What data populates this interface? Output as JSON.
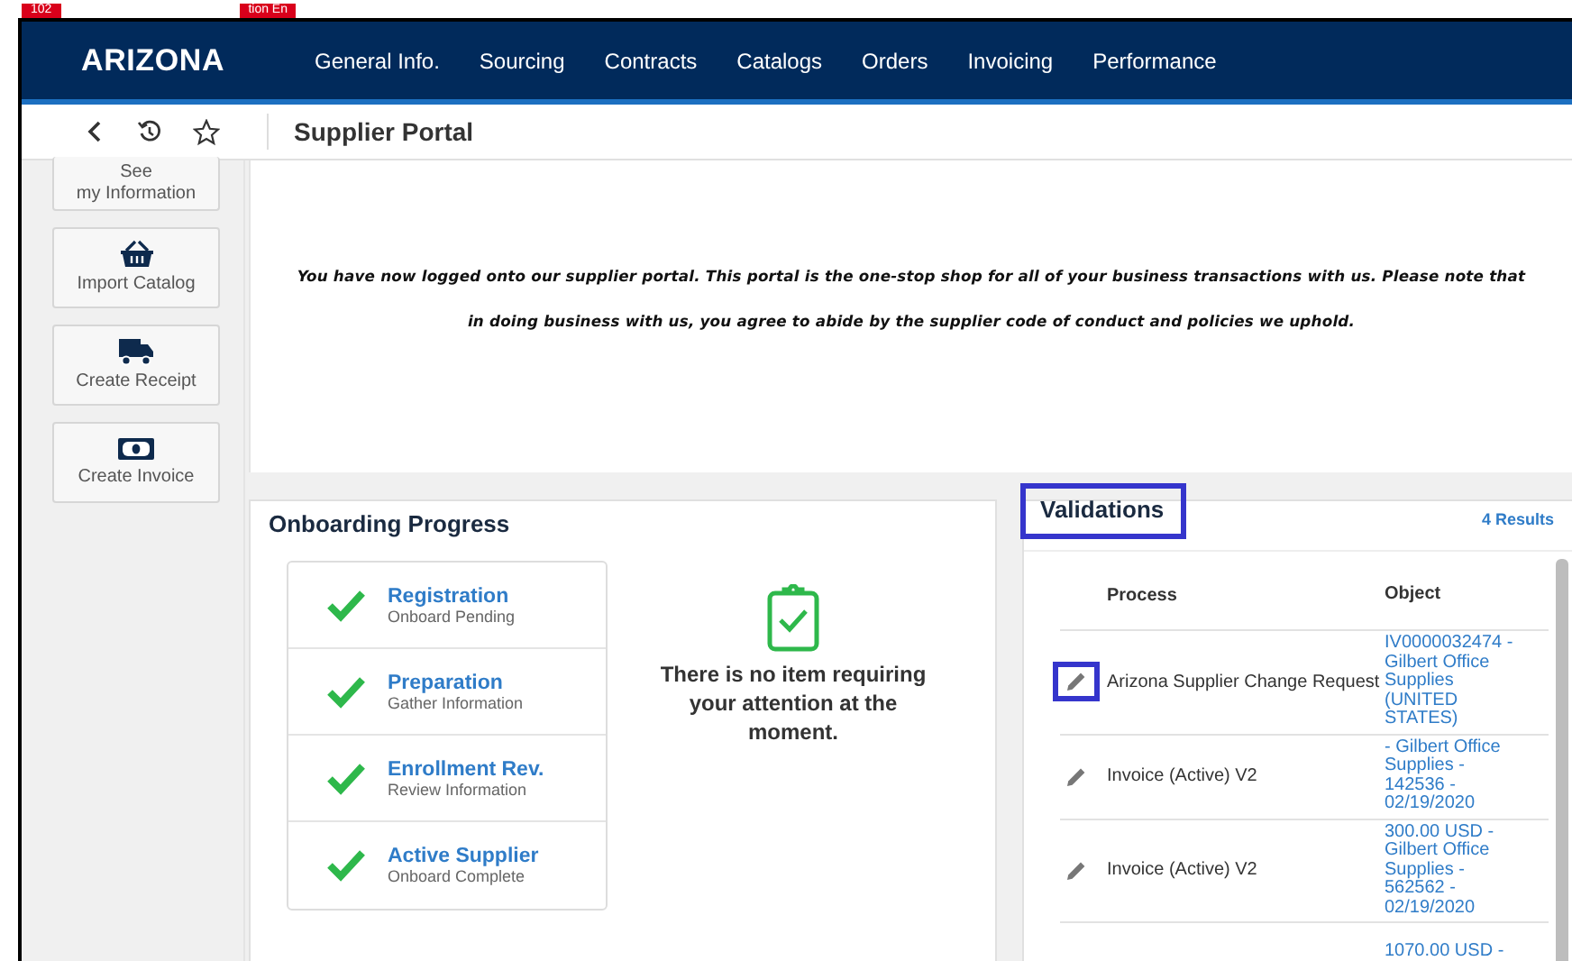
{
  "top_tags": [
    "102",
    "tion En"
  ],
  "nav": {
    "logo": "ARIZONA",
    "items": [
      {
        "label": "General Info.",
        "selected": false
      },
      {
        "label": "Sourcing",
        "selected": false
      },
      {
        "label": "Contracts",
        "selected": false
      },
      {
        "label": "Catalogs",
        "selected": false
      },
      {
        "label": "Orders",
        "selected": false
      },
      {
        "label": "Invoicing",
        "selected": false
      },
      {
        "label": "Performance",
        "selected": false
      }
    ]
  },
  "toolbar": {
    "title": "Supplier Portal"
  },
  "sidebar": [
    {
      "kind": "info",
      "label": "See\nmy Information"
    },
    {
      "kind": "basket",
      "label": "Import Catalog"
    },
    {
      "kind": "truck",
      "label": "Create Receipt"
    },
    {
      "kind": "money",
      "label": "Create Invoice"
    }
  ],
  "welcome": "You have now logged onto our supplier portal. This portal is the one-stop shop for all of your business transactions with us. Please note that in doing business with us, you agree to abide by the supplier code of conduct and policies we uphold.",
  "onboarding": {
    "title": "Onboarding Progress",
    "steps": [
      {
        "name": "Registration",
        "status": "Onboard Pending",
        "done": true
      },
      {
        "name": "Preparation",
        "status": "Gather Information",
        "done": true
      },
      {
        "name": "Enrollment Rev.",
        "status": "Review Information",
        "done": true
      },
      {
        "name": "Active Supplier",
        "status": "Onboard Complete",
        "done": true
      }
    ],
    "empty_message": "There is no item requiring your attention at the moment."
  },
  "validations": {
    "title": "Validations",
    "highlighted": true,
    "results": "4 Results",
    "columns": [
      "Process",
      "Object"
    ],
    "rows": [
      {
        "highlighted": true,
        "process": "Arizona Supplier Change Request",
        "object": "IV0000032474 - Gilbert Office Supplies (UNITED STATES)"
      },
      {
        "highlighted": false,
        "process": "Invoice (Active) V2",
        "object": "- Gilbert Office Supplies - 142536 - 02/19/2020"
      },
      {
        "highlighted": false,
        "process": "Invoice (Active) V2",
        "object": "300.00 USD - Gilbert Office Supplies - 562562 - 02/19/2020"
      },
      {
        "process": "",
        "object": "1070.00 USD -"
      }
    ]
  }
}
